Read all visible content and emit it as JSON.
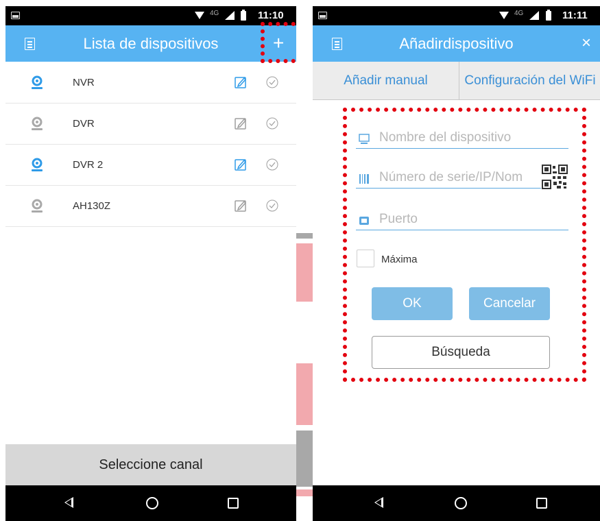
{
  "left_screen": {
    "status_bar": {
      "network": "4G",
      "time": "11:10"
    },
    "app_bar": {
      "title": "Lista de dispositivos"
    },
    "devices": [
      {
        "name": "NVR",
        "state": "online"
      },
      {
        "name": "DVR",
        "state": "offline"
      },
      {
        "name": "DVR 2",
        "state": "online"
      },
      {
        "name": "AH130Z",
        "state": "offline"
      }
    ],
    "bottom_panel": {
      "label": "Seleccione canal"
    }
  },
  "right_screen": {
    "status_bar": {
      "network": "4G",
      "time": "11:11"
    },
    "app_bar": {
      "title": "Añadirdispositivo"
    },
    "tabs": [
      {
        "label": "Añadir manual"
      },
      {
        "label": "Configuración del WiFi"
      }
    ],
    "form": {
      "device_name_placeholder": "Nombre del dispositivo",
      "serial_placeholder": "Número de serie/IP/Nom",
      "port_placeholder": "Puerto",
      "checkbox_label": "Máxima",
      "ok_label": "OK",
      "cancel_label": "Cancelar",
      "search_label": "Búsqueda"
    }
  },
  "colors": {
    "accent": "#57b3f2",
    "online_icon": "#2f9be8",
    "offline_icon": "#a9a9a9",
    "highlight": "#e3000f"
  },
  "icons": {
    "menu": "document-list-icon",
    "add": "plus-icon",
    "close": "close-icon",
    "camera": "camera-icon",
    "edit": "edit-icon",
    "check": "check-circle-icon",
    "qr": "qr-code-icon"
  }
}
